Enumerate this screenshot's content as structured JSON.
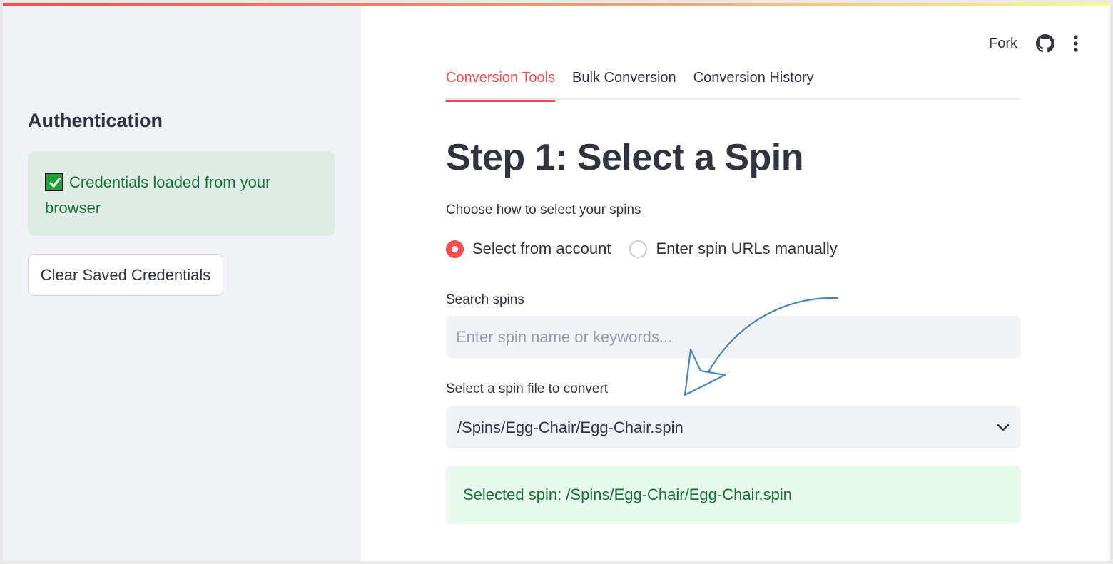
{
  "sidebar": {
    "heading": "Authentication",
    "alert_text": "Credentials loaded from your browser",
    "clear_button_label": "Clear Saved Credentials"
  },
  "header": {
    "fork_label": "Fork",
    "icons": [
      "github-icon",
      "kebab-menu-icon"
    ]
  },
  "tabs": [
    {
      "label": "Conversion Tools",
      "active": true
    },
    {
      "label": "Bulk Conversion",
      "active": false
    },
    {
      "label": "Conversion History",
      "active": false
    }
  ],
  "main": {
    "title": "Step 1: Select a Spin",
    "choose_label": "Choose how to select your spins",
    "radio_options": [
      {
        "label": "Select from account",
        "checked": true
      },
      {
        "label": "Enter spin URLs manually",
        "checked": false
      }
    ],
    "search_label": "Search spins",
    "search_placeholder": "Enter spin name or keywords...",
    "select_label": "Select a spin file to convert",
    "select_value": "/Spins/Egg-Chair/Egg-Chair.spin",
    "selected_message": "Selected spin: /Spins/Egg-Chair/Egg-Chair.spin"
  },
  "colors": {
    "accent": "#ff4b4b",
    "success_text": "#177233",
    "sidebar_bg": "#f0f2f6",
    "annotation_arrow": "#4a86b8"
  }
}
